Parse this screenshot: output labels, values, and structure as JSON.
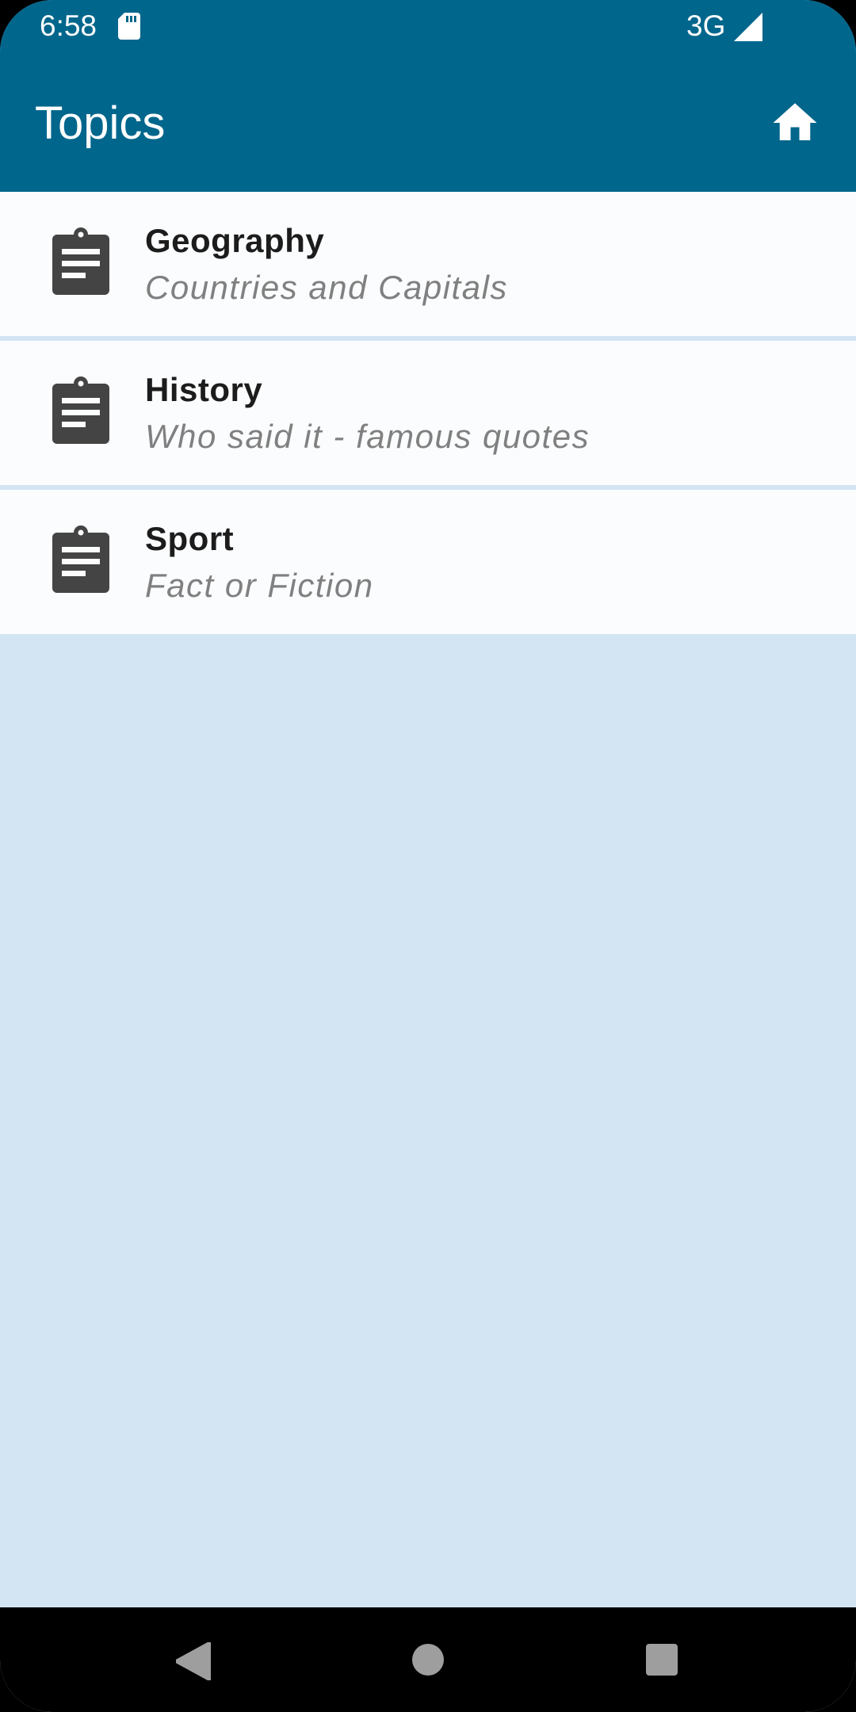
{
  "status_bar": {
    "time": "6:58",
    "network": "3G",
    "icons": [
      "sd-card-icon",
      "signal-icon"
    ]
  },
  "app_bar": {
    "title": "Topics",
    "action_icon": "home-icon",
    "background": "#00668c"
  },
  "topics": [
    {
      "name": "Geography",
      "description": "Countries and Capitals",
      "icon": "clipboard-icon"
    },
    {
      "name": "History",
      "description": "Who said it - famous quotes",
      "icon": "clipboard-icon"
    },
    {
      "name": "Sport",
      "description": "Fact or Fiction",
      "icon": "clipboard-icon"
    }
  ],
  "nav_bar": {
    "buttons": [
      "back-icon",
      "home-circle-icon",
      "recents-square-icon"
    ]
  },
  "colors": {
    "app_bar": "#00668c",
    "page_background": "#d3e5f3",
    "list_item_background": "#fbfcfe",
    "icon": "#444444"
  }
}
